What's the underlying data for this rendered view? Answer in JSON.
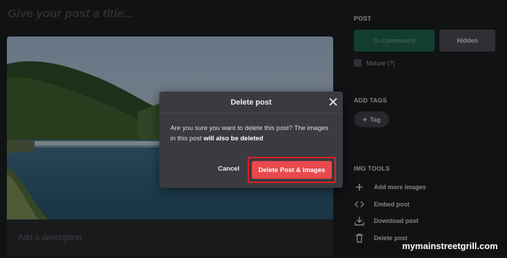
{
  "editor": {
    "title_placeholder": "Give your post a title...",
    "description_placeholder": "Add a description"
  },
  "sidebar": {
    "post_heading": "POST",
    "to_community_label": "To Community",
    "hidden_label": "Hidden",
    "mature_label": "Mature (?)",
    "add_tags_heading": "ADD TAGS",
    "tag_button_label": "Tag",
    "img_tools_heading": "IMG TOOLS",
    "tools": [
      {
        "label": "Add more images",
        "icon": "plus-icon"
      },
      {
        "label": "Embed post",
        "icon": "code-icon"
      },
      {
        "label": "Download post",
        "icon": "download-icon"
      },
      {
        "label": "Delete post",
        "icon": "trash-icon"
      }
    ]
  },
  "dialog": {
    "title": "Delete post",
    "message_part1": "Are you sure you want to delete this post? The images in this post ",
    "message_bold": "will also be deleted",
    "cancel_label": "Cancel",
    "confirm_label": "Delete Post & Images"
  },
  "watermark": "mymainstreetgrill.com",
  "colors": {
    "background": "#1b1c1f",
    "dialog": "#3a3b40",
    "danger": "#e84a4d",
    "highlight": "#e0201f",
    "community_green": "#1e5e4c"
  }
}
